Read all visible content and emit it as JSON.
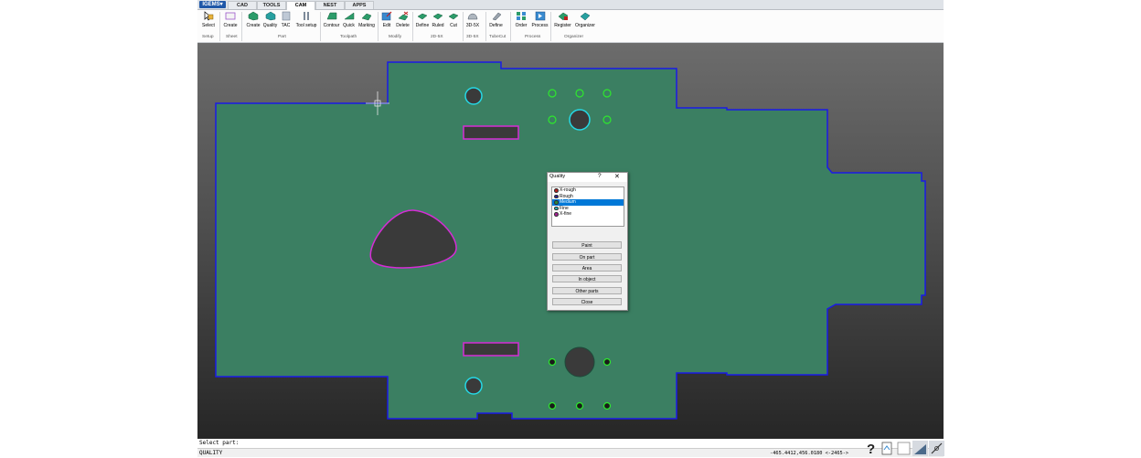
{
  "app": {
    "brand": "IGEMS▾"
  },
  "tabs": [
    "CAD",
    "TOOLS",
    "CAM",
    "NEST",
    "APPS"
  ],
  "active_tab": "CAM",
  "ribbon": {
    "tools": [
      {
        "label": "Select",
        "icon": "select-arrow-icon"
      },
      {
        "label": "Create",
        "icon": "sheet-icon"
      },
      {
        "label": "Create",
        "icon": "part-create-icon"
      },
      {
        "label": "Quality",
        "icon": "quality-icon"
      },
      {
        "label": "TAC",
        "icon": "tac-icon"
      },
      {
        "label": "Tool setup",
        "icon": "tool-setup-icon"
      },
      {
        "label": "Contour",
        "icon": "contour-icon"
      },
      {
        "label": "Quick",
        "icon": "quick-icon"
      },
      {
        "label": "Marking",
        "icon": "marking-icon"
      },
      {
        "label": "Edit",
        "icon": "edit-icon"
      },
      {
        "label": "Delete",
        "icon": "delete-icon"
      },
      {
        "label": "Define",
        "icon": "define-2d-icon"
      },
      {
        "label": "Ruled",
        "icon": "ruled-icon"
      },
      {
        "label": "Cut",
        "icon": "cut-icon"
      },
      {
        "label": "3D-5X",
        "icon": "dome-3d-icon"
      },
      {
        "label": "Define",
        "icon": "tubecut-define-icon"
      },
      {
        "label": "Order",
        "icon": "order-icon"
      },
      {
        "label": "Process",
        "icon": "process-icon"
      },
      {
        "label": "Register",
        "icon": "register-icon"
      },
      {
        "label": "Organizer",
        "icon": "organizer-icon"
      }
    ],
    "groups": [
      "Setup",
      "Sheet",
      "Part",
      "Toolpath",
      "Modify",
      "2D-5X",
      "3D-5X",
      "TubeCut",
      "Process",
      "Organizer"
    ]
  },
  "dialog": {
    "title": "Quality",
    "help": "?",
    "close": "✕",
    "qualities": [
      {
        "label": "X-rough",
        "color": "#b22222"
      },
      {
        "label": "Rough",
        "color": "#2a1f8f"
      },
      {
        "label": "Medium",
        "color": "#2e8b3a"
      },
      {
        "label": "Fine",
        "color": "#2fb5b5"
      },
      {
        "label": "X-fine",
        "color": "#a0208f"
      }
    ],
    "selected": "Medium",
    "buttons": [
      "Paint",
      "On part",
      "Area",
      "In object",
      "Other parts",
      "Close"
    ]
  },
  "colors": {
    "part_fill": "#3b7f62",
    "outline": "#1a1ae6",
    "hole_cyan": "#25d8e6",
    "hole_magenta": "#d62cd6",
    "hole_green": "#2ee82e",
    "hole_fill": "#3a3a3a"
  },
  "command_line": "Select part:",
  "status": {
    "mode": "QUALITY",
    "coords": "-465.4412,456.0180 <-2465->"
  }
}
